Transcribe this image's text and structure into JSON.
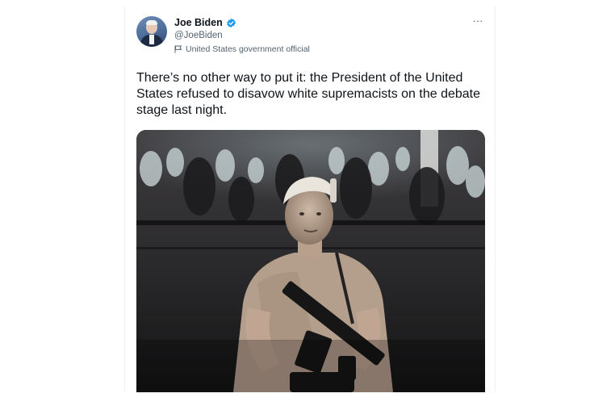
{
  "author": {
    "display_name": "Joe Biden",
    "handle": "@JoeBiden",
    "verified": true,
    "label": "United States government official"
  },
  "tweet": {
    "text": "There’s no other way to put it: the President of the United States refused to disavow white supremacists on the debate stage last night.",
    "more_icon": "···"
  },
  "media": {
    "type": "photo",
    "content": "young man in t-shirt and backwards cap holding a rifle at night with a crowd behind"
  },
  "colors": {
    "text_primary": "#0f1419",
    "text_secondary": "#536471",
    "verified_blue": "#1d9bf0"
  },
  "icons": {
    "verified": "verified-badge-icon",
    "label": "flag-icon",
    "more": "more-options-icon"
  }
}
